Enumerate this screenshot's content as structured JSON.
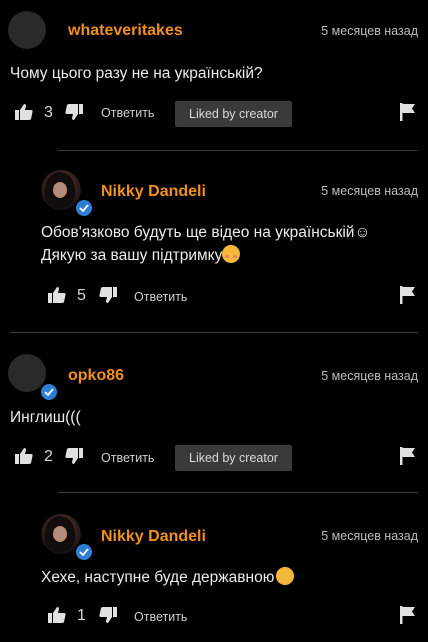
{
  "comments": [
    {
      "author": "whateveritakes",
      "time": "5 месяцев назад",
      "text": "Чому цього разу не на українській?",
      "likes": "3",
      "reply_label": "Ответить",
      "badge": "Liked by creator",
      "avatar_verified": false
    },
    {
      "author": "Nikky Dandeli",
      "time": "5 месяцев назад",
      "text_line1": "Обов'язково будуть ще відео на українській☺",
      "text_line2": "Дякую за вашу підтримку",
      "likes": "5",
      "reply_label": "Ответить",
      "avatar_verified": true
    },
    {
      "author": "opko86",
      "time": "5 месяцев назад",
      "text": "Инглиш(((",
      "likes": "2",
      "reply_label": "Ответить",
      "badge": "Liked by creator",
      "avatar_verified": true
    },
    {
      "author": "Nikky Dandeli",
      "time": "5 месяцев назад",
      "text": "Хехе, наступне буде державною",
      "likes": "1",
      "reply_label": "Ответить",
      "avatar_verified": true
    }
  ],
  "icons": {
    "like": "thumbs-up-icon",
    "dislike": "thumbs-down-icon",
    "flag": "flag-icon",
    "verified": "check-badge-icon",
    "emoji_smiling_hearts": "smiling-face-with-hearts-icon",
    "emoji_star_struck": "star-struck-icon"
  },
  "colors": {
    "background": "#000000",
    "author": "#f0901e",
    "badge_bg": "#3a3a3a",
    "verified": "#2d7fd6"
  }
}
